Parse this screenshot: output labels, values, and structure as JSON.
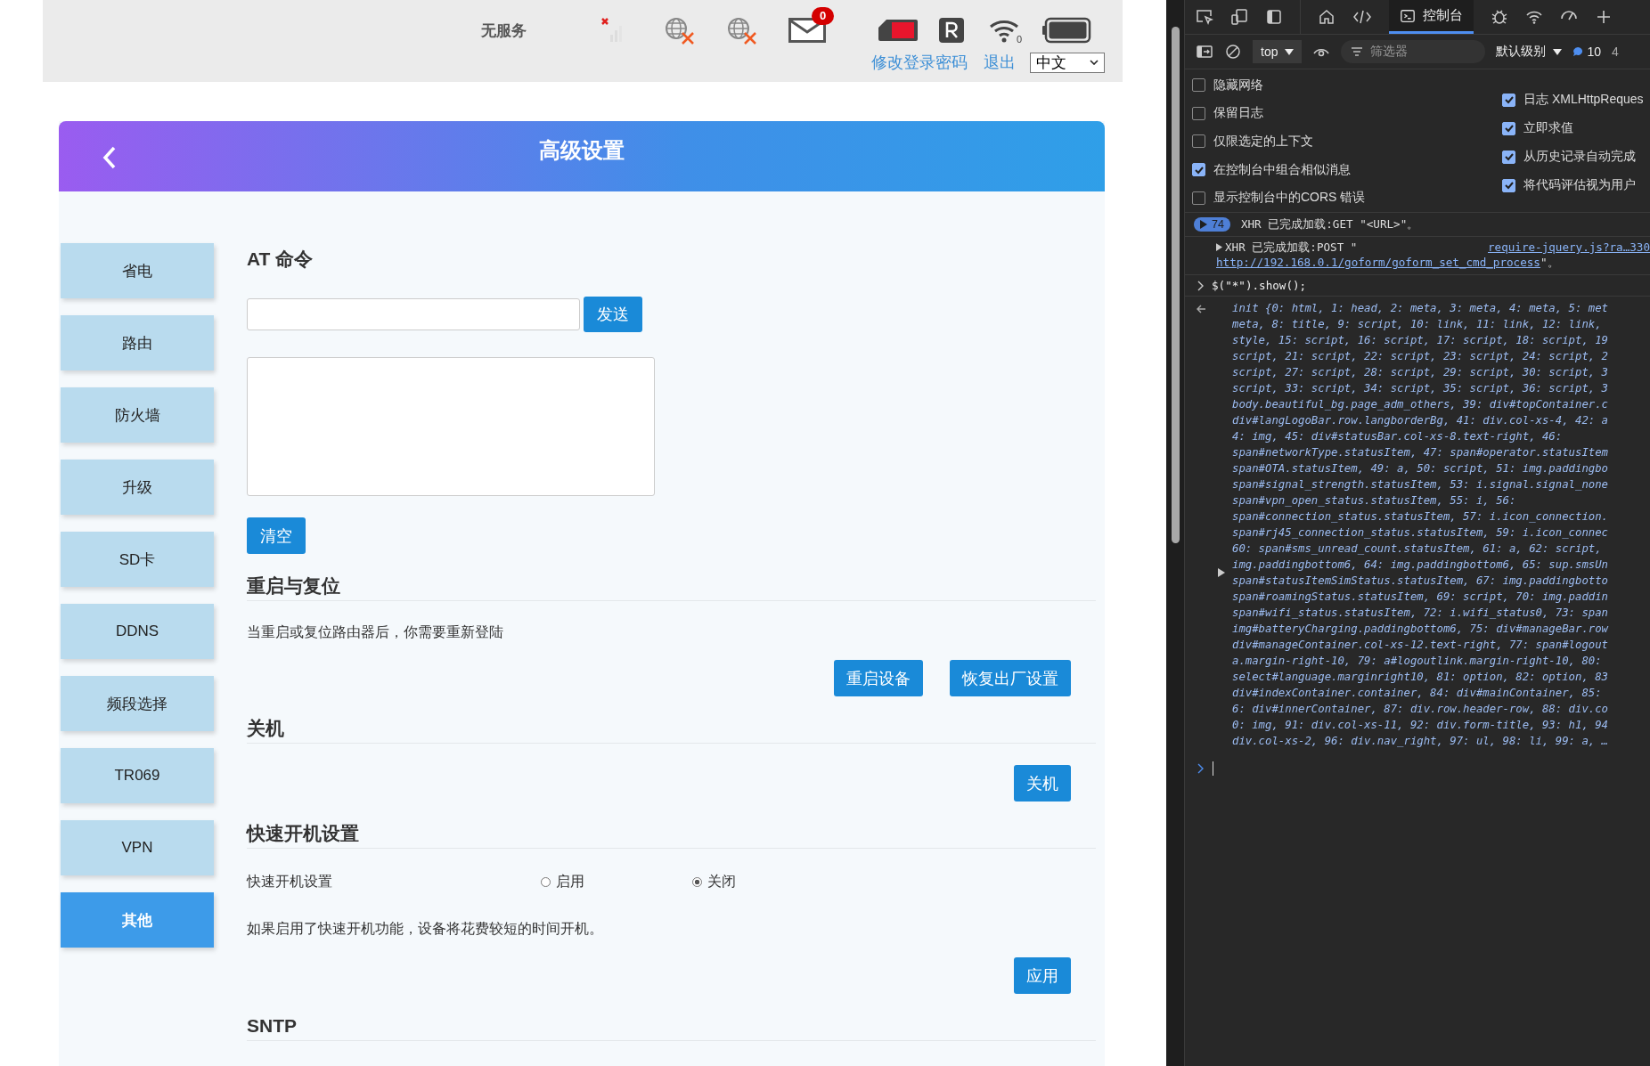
{
  "status_bar": {
    "network": "无服务",
    "sms_count": "0",
    "wifi_clients": "0",
    "links": [
      "修改登录密码",
      "退出"
    ],
    "language": "中文"
  },
  "header": {
    "title": "高级设置"
  },
  "sidebar": {
    "items": [
      {
        "label": "省电",
        "selected": false
      },
      {
        "label": "路由",
        "selected": false
      },
      {
        "label": "防火墙",
        "selected": false
      },
      {
        "label": "升级",
        "selected": false
      },
      {
        "label": "SD卡",
        "selected": false
      },
      {
        "label": "DDNS",
        "selected": false
      },
      {
        "label": "频段选择",
        "selected": false
      },
      {
        "label": "TR069",
        "selected": false
      },
      {
        "label": "VPN",
        "selected": false
      },
      {
        "label": "其他",
        "selected": true
      }
    ]
  },
  "at_command": {
    "title": "AT 命令",
    "send_button": "发送",
    "clear_button": "清空"
  },
  "reboot": {
    "title": "重启与复位",
    "note": "当重启或复位路由器后，你需要重新登陆",
    "buttons": [
      "重启设备",
      "恢复出厂设置"
    ]
  },
  "shutdown": {
    "title": "关机",
    "button": "关机"
  },
  "fast_boot": {
    "title": "快速开机设置",
    "label": "快速开机设置",
    "options": [
      {
        "label": "启用",
        "selected": false
      },
      {
        "label": "关闭",
        "selected": true
      }
    ],
    "note": "如果启用了快速开机功能，设备将花费较短的时间开机。",
    "button": "应用"
  },
  "sntp": {
    "title": "SNTP"
  },
  "devtools": {
    "tabs": [
      {
        "label": "控制台",
        "selected": true
      }
    ],
    "context": "top",
    "filter_placeholder": "筛选器",
    "level": "默认级别",
    "message_count": "10",
    "issue_count": "4",
    "settings_left": [
      {
        "label": "隐藏网络",
        "checked": false
      },
      {
        "label": "保留日志",
        "checked": false
      },
      {
        "label": "仅限选定的上下文",
        "checked": false
      },
      {
        "label": "在控制台中组合相似消息",
        "checked": true
      },
      {
        "label": "显示控制台中的CORS 错误",
        "checked": false
      }
    ],
    "settings_right": [
      {
        "label": "日志 XMLHttpReques",
        "checked": true
      },
      {
        "label": "立即求值",
        "checked": true
      },
      {
        "label": "从历史记录自动完成",
        "checked": true
      },
      {
        "label": "将代码评估视为用户",
        "checked": true
      }
    ],
    "console": {
      "group_count": "74",
      "group_message": "XHR 已完成加载:GET \"<URL>\"。",
      "xhr_message": "XHR 已完成加载:POST \"",
      "source_link": "require-jquery.js?ra…330",
      "url": "http://192.168.0.1/goform/goform_set_cmd_process",
      "url_suffix": "\"。",
      "command": "$(\"*\").show();",
      "result_lines": [
        "init {0: html, 1: head, 2: meta, 3: meta, 4: meta, 5: met",
        "meta, 8: title, 9: script, 10: link, 11: link, 12: link,",
        "style, 15: script, 16: script, 17: script, 18: script, 19",
        "script, 21: script, 22: script, 23: script, 24: script, 2",
        "script, 27: script, 28: script, 29: script, 30: script, 3",
        "script, 33: script, 34: script, 35: script, 36: script, 3",
        "body.beautiful_bg.page_adm_others, 39: div#topContainer.c",
        "div#langLogoBar.row.langborderBg, 41: div.col-xs-4, 42: a",
        "4: img, 45: div#statusBar.col-xs-8.text-right, 46:",
        "span#networkType.statusItem, 47: span#operator.statusItem",
        "span#OTA.statusItem, 49: a, 50: script, 51: img.paddingbo",
        "span#signal_strength.statusItem, 53: i.signal.signal_none",
        "span#vpn_open_status.statusItem, 55: i, 56:",
        "span#connection_status.statusItem, 57: i.icon_connection.",
        "span#rj45_connection_status.statusItem, 59: i.icon_connec",
        "60: span#sms_unread_count.statusItem, 61: a, 62: script,",
        "img.paddingbottom6, 64: img.paddingbottom6, 65: sup.smsUn",
        "span#statusItemSimStatus.statusItem, 67: img.paddingbotto",
        "span#roamingStatus.statusItem, 69: script, 70: img.paddin",
        "span#wifi_status.statusItem, 72: i.wifi_status0, 73: span",
        "img#batteryCharging.paddingbottom6, 75: div#manageBar.row",
        "div#manageContainer.col-xs-12.text-right, 77: span#logout",
        "a.margin-right-10, 79: a#logoutlink.margin-right-10, 80:",
        "select#language.marginright10, 81: option, 82: option, 83",
        "div#indexContainer.container, 84: div#mainContainer, 85:",
        "6: div#innerContainer, 87: div.row.header-row, 88: div.co",
        "0: img, 91: div.col-xs-11, 92: div.form-title, 93: h1, 94",
        "div.col-xs-2, 96: div.nav_right, 97: ul, 98: li, 99: a, …"
      ]
    }
  }
}
